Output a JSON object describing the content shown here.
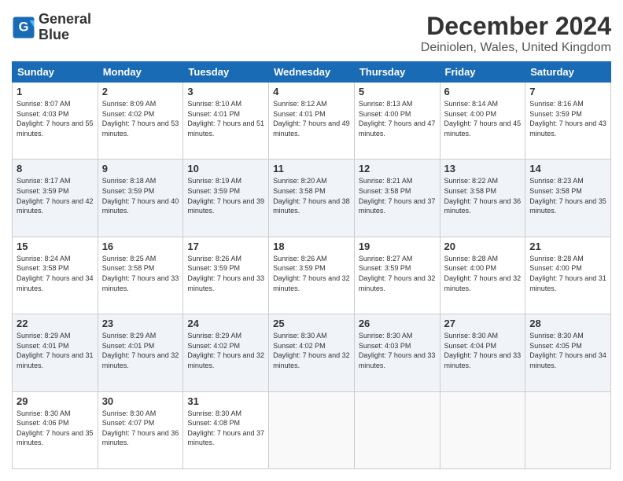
{
  "header": {
    "logo_line1": "General",
    "logo_line2": "Blue",
    "main_title": "December 2024",
    "subtitle": "Deiniolen, Wales, United Kingdom"
  },
  "days_of_week": [
    "Sunday",
    "Monday",
    "Tuesday",
    "Wednesday",
    "Thursday",
    "Friday",
    "Saturday"
  ],
  "weeks": [
    [
      {
        "day": "1",
        "sunrise": "8:07 AM",
        "sunset": "4:03 PM",
        "daylight": "7 hours and 55 minutes."
      },
      {
        "day": "2",
        "sunrise": "8:09 AM",
        "sunset": "4:02 PM",
        "daylight": "7 hours and 53 minutes."
      },
      {
        "day": "3",
        "sunrise": "8:10 AM",
        "sunset": "4:01 PM",
        "daylight": "7 hours and 51 minutes."
      },
      {
        "day": "4",
        "sunrise": "8:12 AM",
        "sunset": "4:01 PM",
        "daylight": "7 hours and 49 minutes."
      },
      {
        "day": "5",
        "sunrise": "8:13 AM",
        "sunset": "4:00 PM",
        "daylight": "7 hours and 47 minutes."
      },
      {
        "day": "6",
        "sunrise": "8:14 AM",
        "sunset": "4:00 PM",
        "daylight": "7 hours and 45 minutes."
      },
      {
        "day": "7",
        "sunrise": "8:16 AM",
        "sunset": "3:59 PM",
        "daylight": "7 hours and 43 minutes."
      }
    ],
    [
      {
        "day": "8",
        "sunrise": "8:17 AM",
        "sunset": "3:59 PM",
        "daylight": "7 hours and 42 minutes."
      },
      {
        "day": "9",
        "sunrise": "8:18 AM",
        "sunset": "3:59 PM",
        "daylight": "7 hours and 40 minutes."
      },
      {
        "day": "10",
        "sunrise": "8:19 AM",
        "sunset": "3:59 PM",
        "daylight": "7 hours and 39 minutes."
      },
      {
        "day": "11",
        "sunrise": "8:20 AM",
        "sunset": "3:58 PM",
        "daylight": "7 hours and 38 minutes."
      },
      {
        "day": "12",
        "sunrise": "8:21 AM",
        "sunset": "3:58 PM",
        "daylight": "7 hours and 37 minutes."
      },
      {
        "day": "13",
        "sunrise": "8:22 AM",
        "sunset": "3:58 PM",
        "daylight": "7 hours and 36 minutes."
      },
      {
        "day": "14",
        "sunrise": "8:23 AM",
        "sunset": "3:58 PM",
        "daylight": "7 hours and 35 minutes."
      }
    ],
    [
      {
        "day": "15",
        "sunrise": "8:24 AM",
        "sunset": "3:58 PM",
        "daylight": "7 hours and 34 minutes."
      },
      {
        "day": "16",
        "sunrise": "8:25 AM",
        "sunset": "3:58 PM",
        "daylight": "7 hours and 33 minutes."
      },
      {
        "day": "17",
        "sunrise": "8:26 AM",
        "sunset": "3:59 PM",
        "daylight": "7 hours and 33 minutes."
      },
      {
        "day": "18",
        "sunrise": "8:26 AM",
        "sunset": "3:59 PM",
        "daylight": "7 hours and 32 minutes."
      },
      {
        "day": "19",
        "sunrise": "8:27 AM",
        "sunset": "3:59 PM",
        "daylight": "7 hours and 32 minutes."
      },
      {
        "day": "20",
        "sunrise": "8:28 AM",
        "sunset": "4:00 PM",
        "daylight": "7 hours and 32 minutes."
      },
      {
        "day": "21",
        "sunrise": "8:28 AM",
        "sunset": "4:00 PM",
        "daylight": "7 hours and 31 minutes."
      }
    ],
    [
      {
        "day": "22",
        "sunrise": "8:29 AM",
        "sunset": "4:01 PM",
        "daylight": "7 hours and 31 minutes."
      },
      {
        "day": "23",
        "sunrise": "8:29 AM",
        "sunset": "4:01 PM",
        "daylight": "7 hours and 32 minutes."
      },
      {
        "day": "24",
        "sunrise": "8:29 AM",
        "sunset": "4:02 PM",
        "daylight": "7 hours and 32 minutes."
      },
      {
        "day": "25",
        "sunrise": "8:30 AM",
        "sunset": "4:02 PM",
        "daylight": "7 hours and 32 minutes."
      },
      {
        "day": "26",
        "sunrise": "8:30 AM",
        "sunset": "4:03 PM",
        "daylight": "7 hours and 33 minutes."
      },
      {
        "day": "27",
        "sunrise": "8:30 AM",
        "sunset": "4:04 PM",
        "daylight": "7 hours and 33 minutes."
      },
      {
        "day": "28",
        "sunrise": "8:30 AM",
        "sunset": "4:05 PM",
        "daylight": "7 hours and 34 minutes."
      }
    ],
    [
      {
        "day": "29",
        "sunrise": "8:30 AM",
        "sunset": "4:06 PM",
        "daylight": "7 hours and 35 minutes."
      },
      {
        "day": "30",
        "sunrise": "8:30 AM",
        "sunset": "4:07 PM",
        "daylight": "7 hours and 36 minutes."
      },
      {
        "day": "31",
        "sunrise": "8:30 AM",
        "sunset": "4:08 PM",
        "daylight": "7 hours and 37 minutes."
      },
      null,
      null,
      null,
      null
    ]
  ]
}
